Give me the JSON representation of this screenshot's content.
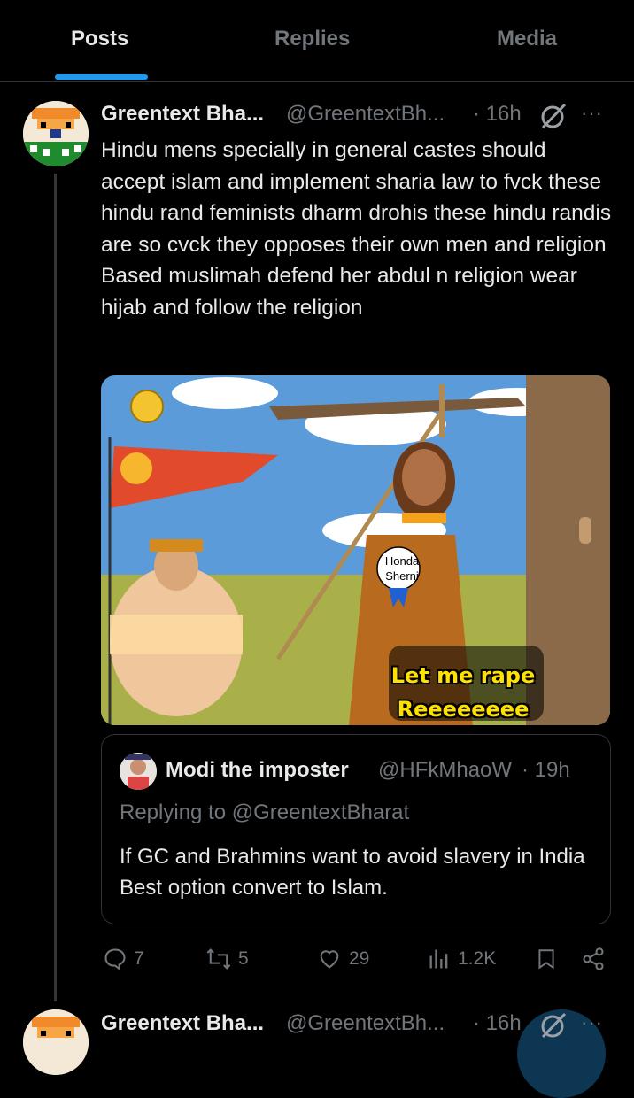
{
  "tabs": [
    {
      "label": "Posts"
    },
    {
      "label": "Replies"
    },
    {
      "label": "Media"
    }
  ],
  "tweet": {
    "author_name": "Greentext Bha...",
    "author_handle": "@GreentextBh...",
    "time": "· 16h",
    "text": "Hindu mens specially in general castes should accept islam and implement sharia law to fvck these hindu rand feminists dharm drohis these hindu randis are so cvck they opposes their own men and religion Based muslimah defend her abdul n religion wear hijab and follow the religion",
    "media": {
      "caption_line1": "Let me rape",
      "caption_line2": "Reeeeeeee",
      "badge_line1": "Honda",
      "badge_line2": "Sherni"
    },
    "quote": {
      "author_name": "Modi the imposter",
      "author_handle": "@HFkMhaoW",
      "time": "· 19h",
      "replying_to": "Replying to @GreentextBharat",
      "text": "If GC and Brahmins want to avoid slavery in India  Best option convert to Islam."
    },
    "actions": {
      "replies": "7",
      "reposts": "5",
      "likes": "29",
      "views": "1.2K"
    }
  },
  "next_tweet": {
    "author_name": "Greentext Bha...",
    "author_handle": "@GreentextBh...",
    "time": "· 16h"
  },
  "colors": {
    "accent": "#1d9bf0",
    "muted": "#71767b",
    "text": "#e7e9ea",
    "background": "#000000"
  },
  "icons": [
    "grok-icon",
    "more-icon",
    "reply-icon",
    "repost-icon",
    "like-icon",
    "views-icon",
    "bookmark-icon",
    "share-icon"
  ]
}
